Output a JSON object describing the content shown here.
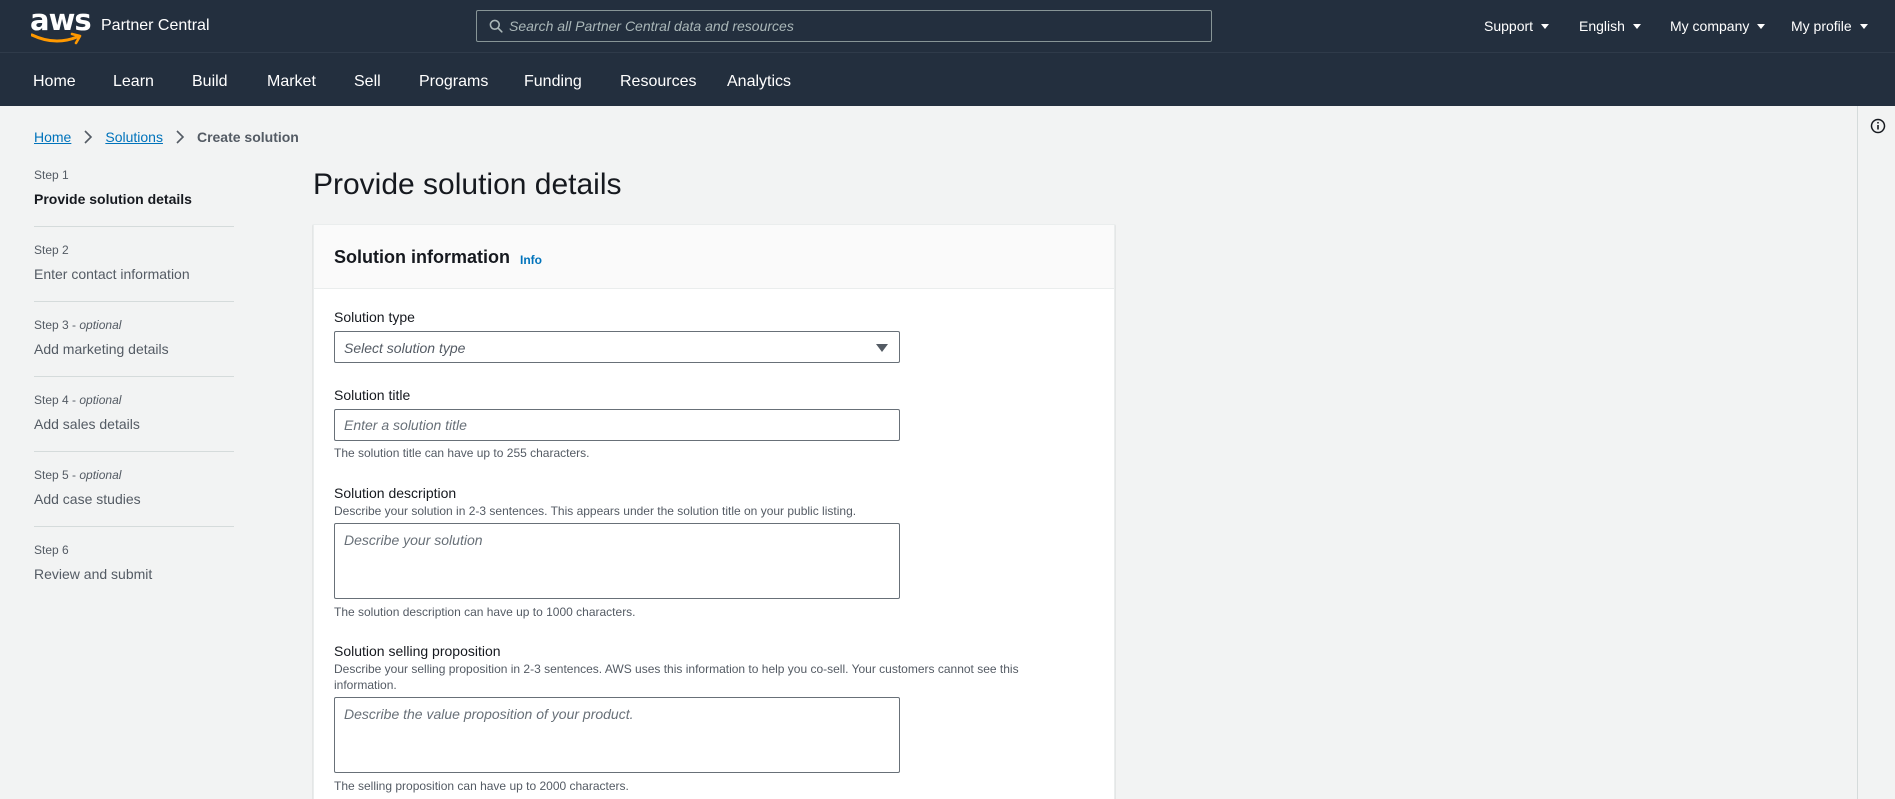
{
  "header": {
    "logo_text": "aws",
    "brand": "Partner Central",
    "search_placeholder": "Search all Partner Central data and resources",
    "utilities": [
      "Support",
      "English",
      "My company",
      "My profile"
    ]
  },
  "nav": [
    "Home",
    "Learn",
    "Build",
    "Market",
    "Sell",
    "Programs",
    "Funding",
    "Resources",
    "Analytics"
  ],
  "breadcrumb": {
    "items": [
      "Home",
      "Solutions"
    ],
    "current": "Create solution"
  },
  "steps": [
    {
      "num": "Step 1",
      "optional": "",
      "title": "Provide solution details",
      "active": true
    },
    {
      "num": "Step 2",
      "optional": "",
      "title": "Enter contact information",
      "active": false
    },
    {
      "num": "Step 3",
      "optional": "optional",
      "title": "Add marketing details",
      "active": false
    },
    {
      "num": "Step 4",
      "optional": "optional",
      "title": "Add sales details",
      "active": false
    },
    {
      "num": "Step 5",
      "optional": "optional",
      "title": "Add case studies",
      "active": false
    },
    {
      "num": "Step 6",
      "optional": "",
      "title": "Review and submit",
      "active": false
    }
  ],
  "step_optional_sep": " - ",
  "page_title": "Provide solution details",
  "panel": {
    "title": "Solution information",
    "info_link": "Info"
  },
  "form": {
    "type_label": "Solution type",
    "type_placeholder": "Select solution type",
    "title_label": "Solution title",
    "title_placeholder": "Enter a solution title",
    "title_constraint": "The solution title can have up to 255 characters.",
    "description_label": "Solution description",
    "description_desc": "Describe your solution in 2-3 sentences. This appears under the solution title on your public listing.",
    "description_placeholder": "Describe your solution",
    "description_constraint": "The solution description can have up to 1000 characters.",
    "proposition_label": "Solution selling proposition",
    "proposition_desc": "Describe your selling proposition in 2-3 sentences. AWS uses this information to help you co-sell. Your customers cannot see this information.",
    "proposition_placeholder": "Describe the value proposition of your product.",
    "proposition_constraint": "The selling proposition can have up to 2000 characters."
  },
  "colors": {
    "header_bg": "#232f3e",
    "link": "#0073bb",
    "page_bg": "#f2f3f3",
    "aws_orange": "#ff9900"
  }
}
